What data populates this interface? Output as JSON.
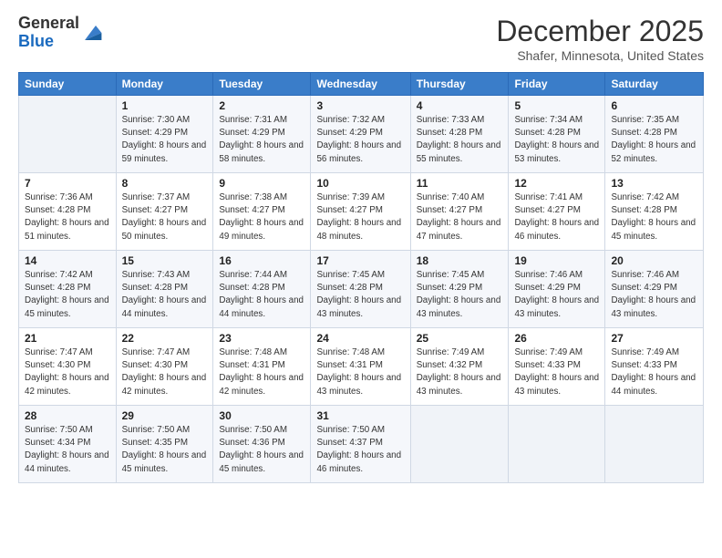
{
  "header": {
    "logo_general": "General",
    "logo_blue": "Blue",
    "month": "December 2025",
    "location": "Shafer, Minnesota, United States"
  },
  "days_of_week": [
    "Sunday",
    "Monday",
    "Tuesday",
    "Wednesday",
    "Thursday",
    "Friday",
    "Saturday"
  ],
  "weeks": [
    [
      {
        "num": "",
        "sunrise": "",
        "sunset": "",
        "daylight": ""
      },
      {
        "num": "1",
        "sunrise": "Sunrise: 7:30 AM",
        "sunset": "Sunset: 4:29 PM",
        "daylight": "Daylight: 8 hours and 59 minutes."
      },
      {
        "num": "2",
        "sunrise": "Sunrise: 7:31 AM",
        "sunset": "Sunset: 4:29 PM",
        "daylight": "Daylight: 8 hours and 58 minutes."
      },
      {
        "num": "3",
        "sunrise": "Sunrise: 7:32 AM",
        "sunset": "Sunset: 4:29 PM",
        "daylight": "Daylight: 8 hours and 56 minutes."
      },
      {
        "num": "4",
        "sunrise": "Sunrise: 7:33 AM",
        "sunset": "Sunset: 4:28 PM",
        "daylight": "Daylight: 8 hours and 55 minutes."
      },
      {
        "num": "5",
        "sunrise": "Sunrise: 7:34 AM",
        "sunset": "Sunset: 4:28 PM",
        "daylight": "Daylight: 8 hours and 53 minutes."
      },
      {
        "num": "6",
        "sunrise": "Sunrise: 7:35 AM",
        "sunset": "Sunset: 4:28 PM",
        "daylight": "Daylight: 8 hours and 52 minutes."
      }
    ],
    [
      {
        "num": "7",
        "sunrise": "Sunrise: 7:36 AM",
        "sunset": "Sunset: 4:28 PM",
        "daylight": "Daylight: 8 hours and 51 minutes."
      },
      {
        "num": "8",
        "sunrise": "Sunrise: 7:37 AM",
        "sunset": "Sunset: 4:27 PM",
        "daylight": "Daylight: 8 hours and 50 minutes."
      },
      {
        "num": "9",
        "sunrise": "Sunrise: 7:38 AM",
        "sunset": "Sunset: 4:27 PM",
        "daylight": "Daylight: 8 hours and 49 minutes."
      },
      {
        "num": "10",
        "sunrise": "Sunrise: 7:39 AM",
        "sunset": "Sunset: 4:27 PM",
        "daylight": "Daylight: 8 hours and 48 minutes."
      },
      {
        "num": "11",
        "sunrise": "Sunrise: 7:40 AM",
        "sunset": "Sunset: 4:27 PM",
        "daylight": "Daylight: 8 hours and 47 minutes."
      },
      {
        "num": "12",
        "sunrise": "Sunrise: 7:41 AM",
        "sunset": "Sunset: 4:27 PM",
        "daylight": "Daylight: 8 hours and 46 minutes."
      },
      {
        "num": "13",
        "sunrise": "Sunrise: 7:42 AM",
        "sunset": "Sunset: 4:28 PM",
        "daylight": "Daylight: 8 hours and 45 minutes."
      }
    ],
    [
      {
        "num": "14",
        "sunrise": "Sunrise: 7:42 AM",
        "sunset": "Sunset: 4:28 PM",
        "daylight": "Daylight: 8 hours and 45 minutes."
      },
      {
        "num": "15",
        "sunrise": "Sunrise: 7:43 AM",
        "sunset": "Sunset: 4:28 PM",
        "daylight": "Daylight: 8 hours and 44 minutes."
      },
      {
        "num": "16",
        "sunrise": "Sunrise: 7:44 AM",
        "sunset": "Sunset: 4:28 PM",
        "daylight": "Daylight: 8 hours and 44 minutes."
      },
      {
        "num": "17",
        "sunrise": "Sunrise: 7:45 AM",
        "sunset": "Sunset: 4:28 PM",
        "daylight": "Daylight: 8 hours and 43 minutes."
      },
      {
        "num": "18",
        "sunrise": "Sunrise: 7:45 AM",
        "sunset": "Sunset: 4:29 PM",
        "daylight": "Daylight: 8 hours and 43 minutes."
      },
      {
        "num": "19",
        "sunrise": "Sunrise: 7:46 AM",
        "sunset": "Sunset: 4:29 PM",
        "daylight": "Daylight: 8 hours and 43 minutes."
      },
      {
        "num": "20",
        "sunrise": "Sunrise: 7:46 AM",
        "sunset": "Sunset: 4:29 PM",
        "daylight": "Daylight: 8 hours and 43 minutes."
      }
    ],
    [
      {
        "num": "21",
        "sunrise": "Sunrise: 7:47 AM",
        "sunset": "Sunset: 4:30 PM",
        "daylight": "Daylight: 8 hours and 42 minutes."
      },
      {
        "num": "22",
        "sunrise": "Sunrise: 7:47 AM",
        "sunset": "Sunset: 4:30 PM",
        "daylight": "Daylight: 8 hours and 42 minutes."
      },
      {
        "num": "23",
        "sunrise": "Sunrise: 7:48 AM",
        "sunset": "Sunset: 4:31 PM",
        "daylight": "Daylight: 8 hours and 42 minutes."
      },
      {
        "num": "24",
        "sunrise": "Sunrise: 7:48 AM",
        "sunset": "Sunset: 4:31 PM",
        "daylight": "Daylight: 8 hours and 43 minutes."
      },
      {
        "num": "25",
        "sunrise": "Sunrise: 7:49 AM",
        "sunset": "Sunset: 4:32 PM",
        "daylight": "Daylight: 8 hours and 43 minutes."
      },
      {
        "num": "26",
        "sunrise": "Sunrise: 7:49 AM",
        "sunset": "Sunset: 4:33 PM",
        "daylight": "Daylight: 8 hours and 43 minutes."
      },
      {
        "num": "27",
        "sunrise": "Sunrise: 7:49 AM",
        "sunset": "Sunset: 4:33 PM",
        "daylight": "Daylight: 8 hours and 44 minutes."
      }
    ],
    [
      {
        "num": "28",
        "sunrise": "Sunrise: 7:50 AM",
        "sunset": "Sunset: 4:34 PM",
        "daylight": "Daylight: 8 hours and 44 minutes."
      },
      {
        "num": "29",
        "sunrise": "Sunrise: 7:50 AM",
        "sunset": "Sunset: 4:35 PM",
        "daylight": "Daylight: 8 hours and 45 minutes."
      },
      {
        "num": "30",
        "sunrise": "Sunrise: 7:50 AM",
        "sunset": "Sunset: 4:36 PM",
        "daylight": "Daylight: 8 hours and 45 minutes."
      },
      {
        "num": "31",
        "sunrise": "Sunrise: 7:50 AM",
        "sunset": "Sunset: 4:37 PM",
        "daylight": "Daylight: 8 hours and 46 minutes."
      },
      {
        "num": "",
        "sunrise": "",
        "sunset": "",
        "daylight": ""
      },
      {
        "num": "",
        "sunrise": "",
        "sunset": "",
        "daylight": ""
      },
      {
        "num": "",
        "sunrise": "",
        "sunset": "",
        "daylight": ""
      }
    ]
  ]
}
